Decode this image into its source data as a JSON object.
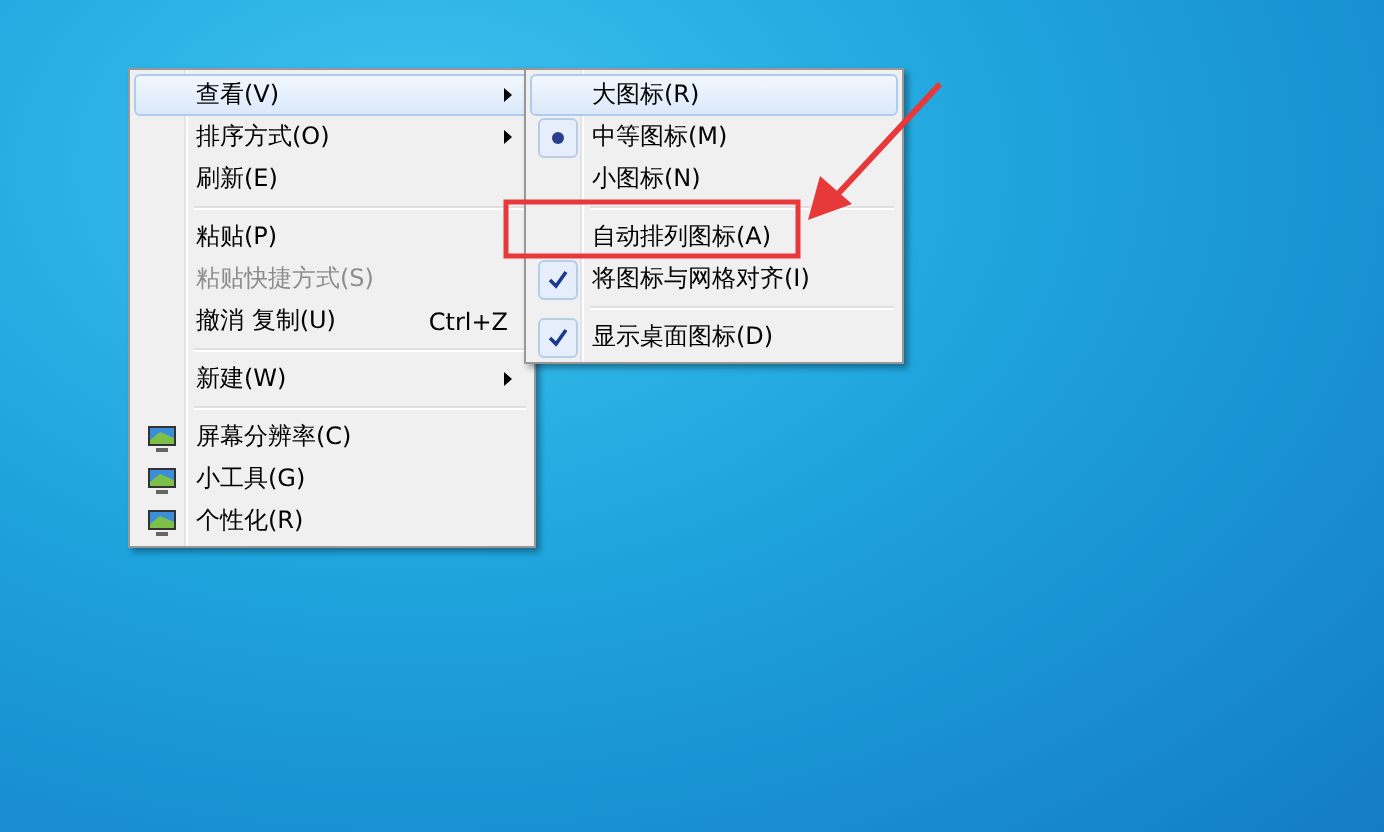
{
  "context_menu": {
    "items": [
      {
        "kind": "item",
        "label": "查看(V)",
        "submenu": true,
        "highlighted": true,
        "disabled": false
      },
      {
        "kind": "item",
        "label": "排序方式(O)",
        "submenu": true,
        "highlighted": false,
        "disabled": false
      },
      {
        "kind": "item",
        "label": "刷新(E)",
        "submenu": false,
        "highlighted": false,
        "disabled": false
      },
      {
        "kind": "separator"
      },
      {
        "kind": "item",
        "label": "粘贴(P)",
        "submenu": false,
        "highlighted": false,
        "disabled": false
      },
      {
        "kind": "item",
        "label": "粘贴快捷方式(S)",
        "submenu": false,
        "highlighted": false,
        "disabled": true
      },
      {
        "kind": "item",
        "label": "撤消 复制(U)",
        "shortcut": "Ctrl+Z",
        "submenu": false,
        "highlighted": false,
        "disabled": false
      },
      {
        "kind": "separator"
      },
      {
        "kind": "item",
        "label": "新建(W)",
        "submenu": true,
        "highlighted": false,
        "disabled": false
      },
      {
        "kind": "separator"
      },
      {
        "kind": "item",
        "label": "屏幕分辨率(C)",
        "icon": true,
        "submenu": false,
        "highlighted": false,
        "disabled": false
      },
      {
        "kind": "item",
        "label": "小工具(G)",
        "icon": true,
        "submenu": false,
        "highlighted": false,
        "disabled": false
      },
      {
        "kind": "item",
        "label": "个性化(R)",
        "icon": true,
        "submenu": false,
        "highlighted": false,
        "disabled": false
      }
    ]
  },
  "view_submenu": {
    "items": [
      {
        "kind": "radio",
        "label": "大图标(R)",
        "selected": false,
        "highlighted": true
      },
      {
        "kind": "radio",
        "label": "中等图标(M)",
        "selected": true,
        "highlighted": false
      },
      {
        "kind": "radio",
        "label": "小图标(N)",
        "selected": false,
        "highlighted": false
      },
      {
        "kind": "separator"
      },
      {
        "kind": "check",
        "label": "自动排列图标(A)",
        "checked": false,
        "highlighted": false
      },
      {
        "kind": "check",
        "label": "将图标与网格对齐(I)",
        "checked": true,
        "highlighted": false
      },
      {
        "kind": "separator"
      },
      {
        "kind": "check",
        "label": "显示桌面图标(D)",
        "checked": true,
        "highlighted": false
      }
    ]
  }
}
